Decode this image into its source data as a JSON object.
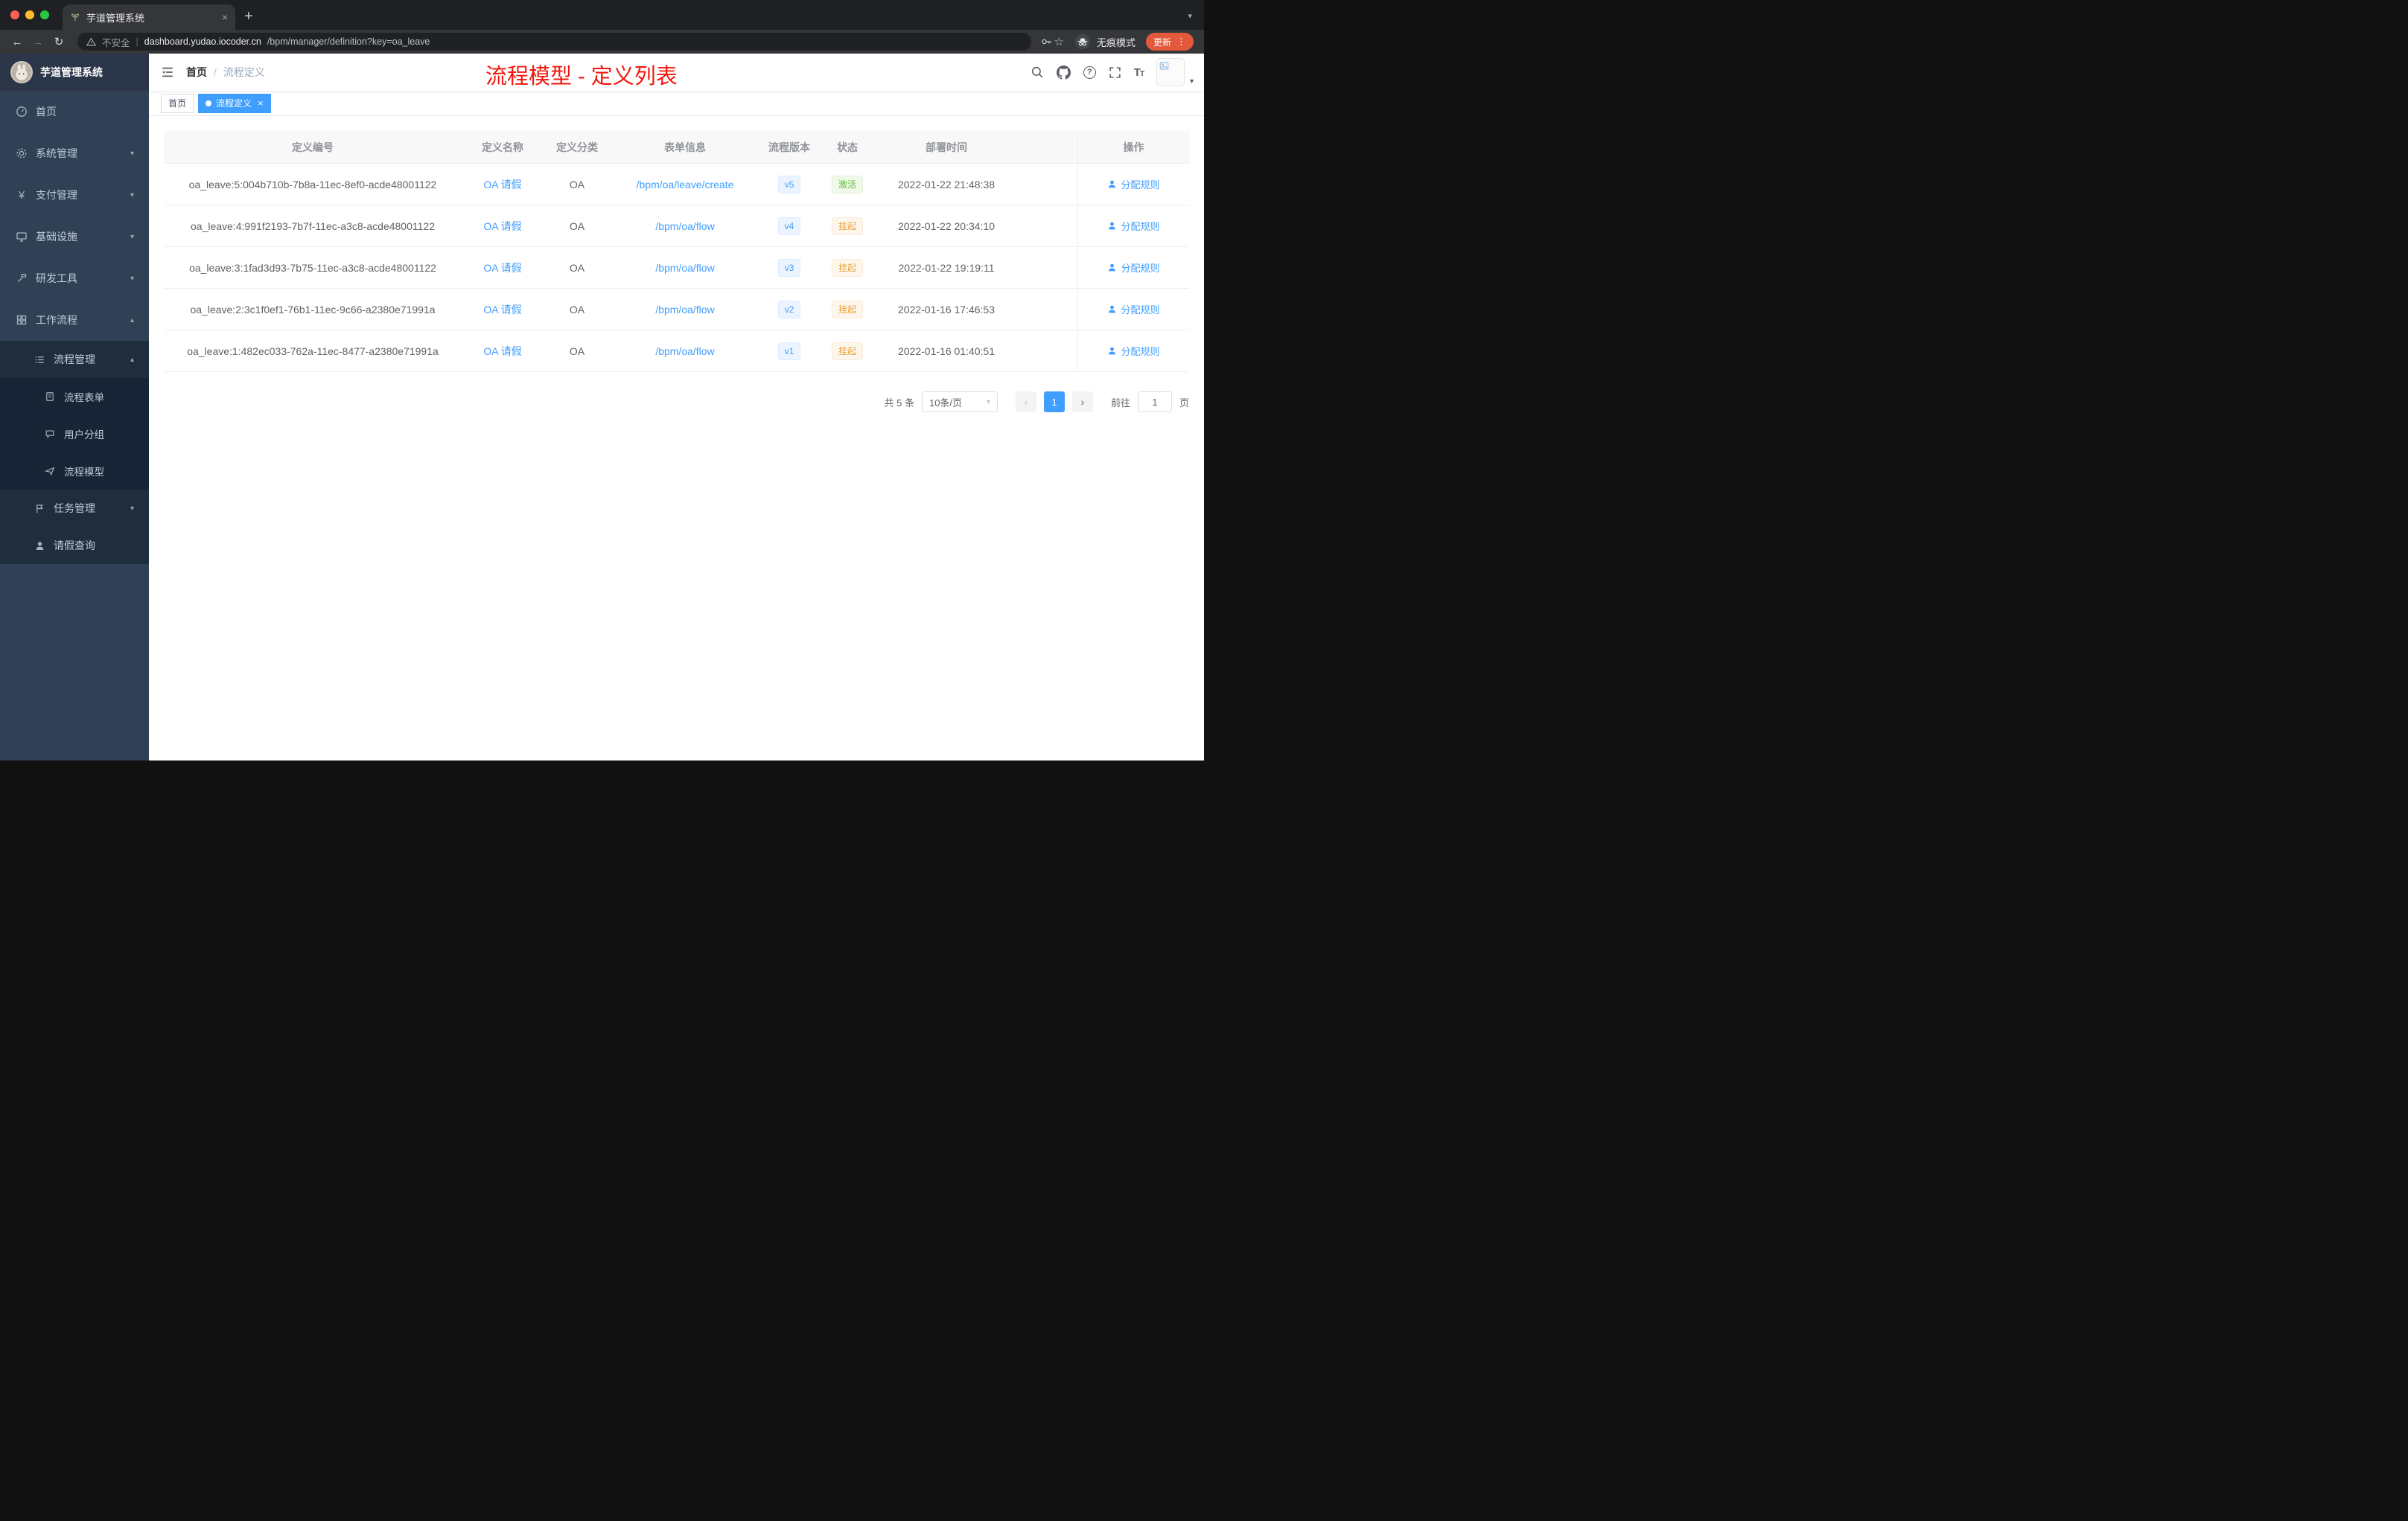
{
  "browser": {
    "tab_title": "芋道管理系统",
    "security_label": "不安全",
    "url_host": "dashboard.yudao.iocoder.cn",
    "url_path": "/bpm/manager/definition?key=oa_leave",
    "incognito_label": "无痕模式",
    "update_label": "更新"
  },
  "sidebar": {
    "logo_title": "芋道管理系统",
    "items": {
      "home": "首页",
      "system": "系统管理",
      "payment": "支付管理",
      "infra": "基础设施",
      "devtools": "研发工具",
      "workflow": "工作流程",
      "process_mgmt": "流程管理",
      "process_form": "流程表单",
      "user_group": "用户分组",
      "process_model": "流程模型",
      "task_mgmt": "任务管理",
      "leave_query": "请假查询"
    }
  },
  "header": {
    "breadcrumb_home": "首页",
    "breadcrumb_sep": "/",
    "breadcrumb_current": "流程定义",
    "annotation": "流程模型 - 定义列表"
  },
  "tags": {
    "home": "首页",
    "active": "流程定义"
  },
  "table": {
    "columns": [
      "定义编号",
      "定义名称",
      "定义分类",
      "表单信息",
      "流程版本",
      "状态",
      "部署时间",
      "操作"
    ],
    "rows": [
      {
        "id": "oa_leave:5:004b710b-7b8a-11ec-8ef0-acde48001122",
        "name": "OA 请假",
        "category": "OA",
        "form": "/bpm/oa/leave/create",
        "version": "v5",
        "status": "激活",
        "status_type": "success",
        "time": "2022-01-22 21:48:38",
        "action": "分配规则"
      },
      {
        "id": "oa_leave:4:991f2193-7b7f-11ec-a3c8-acde48001122",
        "name": "OA 请假",
        "category": "OA",
        "form": "/bpm/oa/flow",
        "version": "v4",
        "status": "挂起",
        "status_type": "warning",
        "time": "2022-01-22 20:34:10",
        "action": "分配规则"
      },
      {
        "id": "oa_leave:3:1fad3d93-7b75-11ec-a3c8-acde48001122",
        "name": "OA 请假",
        "category": "OA",
        "form": "/bpm/oa/flow",
        "version": "v3",
        "status": "挂起",
        "status_type": "warning",
        "time": "2022-01-22 19:19:11",
        "action": "分配规则"
      },
      {
        "id": "oa_leave:2:3c1f0ef1-76b1-11ec-9c66-a2380e71991a",
        "name": "OA 请假",
        "category": "OA",
        "form": "/bpm/oa/flow",
        "version": "v2",
        "status": "挂起",
        "status_type": "warning",
        "time": "2022-01-16 17:46:53",
        "action": "分配规则"
      },
      {
        "id": "oa_leave:1:482ec033-762a-11ec-8477-a2380e71991a",
        "name": "OA 请假",
        "category": "OA",
        "form": "/bpm/oa/flow",
        "version": "v1",
        "status": "挂起",
        "status_type": "warning",
        "time": "2022-01-16 01:40:51",
        "action": "分配规则"
      }
    ]
  },
  "pagination": {
    "total": "共 5 条",
    "page_size": "10条/页",
    "current_page": "1",
    "goto_label": "前往",
    "goto_value": "1",
    "unit_label": "页"
  },
  "colors": {
    "accent": "#409eff",
    "success": "#67c23a",
    "warning": "#e6a23c",
    "annotation_red": "#f2170d",
    "sidebar_bg": "#304156",
    "submenu_bg": "#1f2d3d",
    "update_badge": "#e2593c"
  }
}
